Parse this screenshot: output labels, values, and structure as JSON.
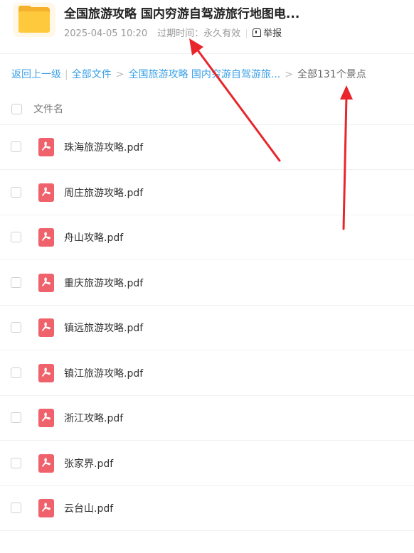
{
  "header": {
    "title": "全国旅游攻略 国内穷游自驾游旅行地图电...",
    "date": "2025-04-05 10:20",
    "expiry_label": "过期时间：永久有效",
    "report_label": "举报"
  },
  "breadcrumb": {
    "back": "返回上一级",
    "all_files": "全部文件",
    "folder": "全国旅游攻略 国内穷游自驾游旅...",
    "count": "全部131个景点"
  },
  "list": {
    "column_header": "文件名",
    "files": [
      "珠海旅游攻略.pdf",
      "周庄旅游攻略.pdf",
      "舟山攻略.pdf",
      "重庆旅游攻略.pdf",
      "镇远旅游攻略.pdf",
      "镇江旅游攻略.pdf",
      "浙江攻略.pdf",
      "张家界.pdf",
      "云台山.pdf"
    ]
  },
  "colors": {
    "link": "#3aa0e8",
    "pdf_icon": "#f0626b",
    "folder": "#ffc93d",
    "annotation_arrow": "#e8262b"
  }
}
